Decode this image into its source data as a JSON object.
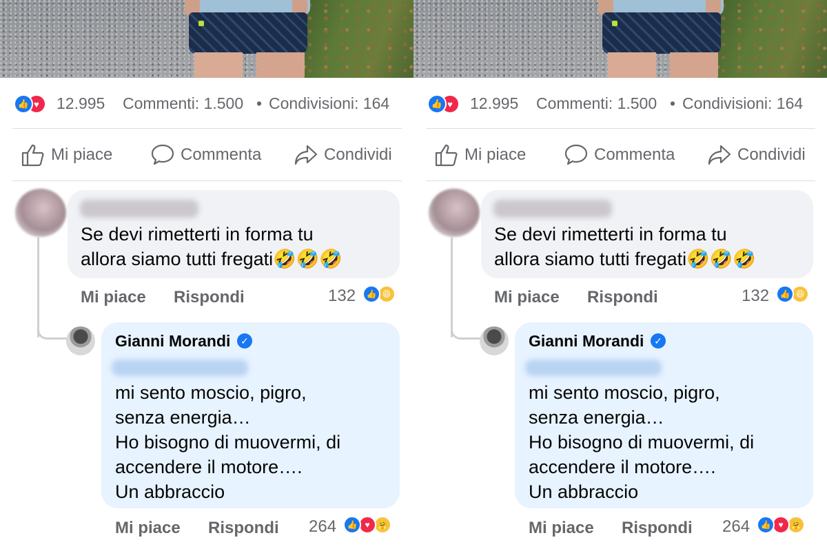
{
  "post": {
    "stats": {
      "likes": "12.995",
      "comments": "Commenti: 1.500",
      "separator": "•",
      "shares": "Condivisioni: 164"
    },
    "actions": {
      "like": "Mi piace",
      "comment": "Commenta",
      "share": "Condividi"
    }
  },
  "comments": [
    {
      "author": "",
      "text": "Se devi rimetterti in forma tu\nallora siamo tutti fregati🤣🤣🤣",
      "like_label": "Mi piace",
      "reply_label": "Rispondi",
      "reaction_count": "132",
      "reactions": [
        "like-icon",
        "haha-icon"
      ]
    },
    {
      "author": "Gianni Morandi",
      "verified": true,
      "text": "mi sento moscio, pigro,\nsenza energia…\nHo bisogno di muovermi, di\naccendere il motore….\nUn abbraccio",
      "like_label": "Mi piace",
      "reply_label": "Rispondi",
      "reaction_count": "264",
      "reactions": [
        "like-icon",
        "love-icon",
        "care-icon"
      ]
    }
  ],
  "colors": {
    "like_blue": "#1877f2",
    "love_red": "#f0284a",
    "haha_yellow": "#f7c33d",
    "comment_bubble": "#f0f2f5",
    "reply_bubble": "#e7f3ff",
    "secondary_text": "#65676b"
  }
}
